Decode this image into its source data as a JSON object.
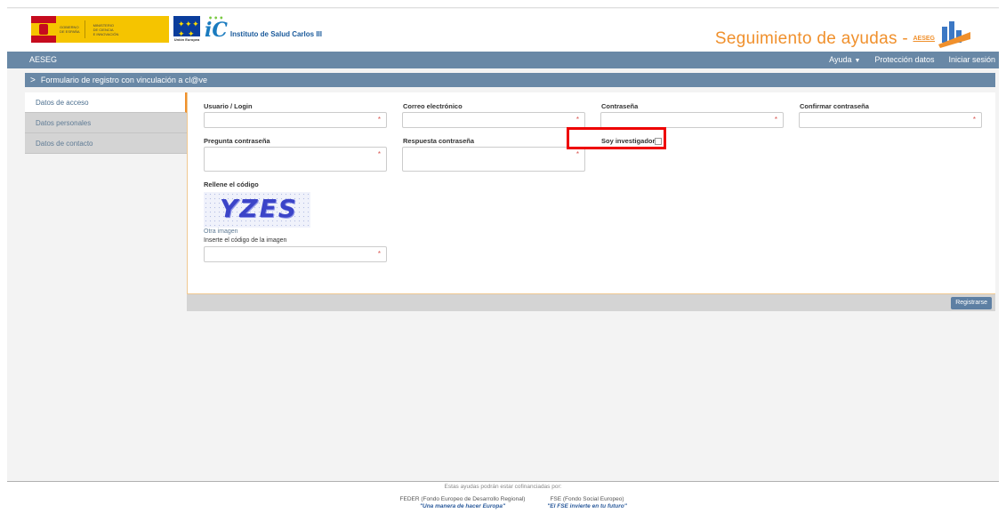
{
  "header": {
    "gov_logo": {
      "lines_a": [
        "GOBIERNO",
        "DE ESPAÑA"
      ],
      "lines_b": [
        "MINISTERIO",
        "DE CIENCIA",
        "E INNOVACIÓN"
      ],
      "flag_color": "#c60b1e",
      "band_color": "#f5c400"
    },
    "eu_logo": {
      "label": "Unión Europea",
      "color": "#0a3d9c"
    },
    "institute": {
      "name": "Instituto de Salud Carlos III",
      "color": "#1a7bbf"
    },
    "brand_title": "Seguimiento de ayudas -",
    "brand_short": "AESEG",
    "accent_color": "#f0902c"
  },
  "navbar": {
    "brand": "AESEG",
    "help": "Ayuda",
    "privacy": "Protección datos",
    "login": "Iniciar sesión",
    "color": "#6988a6"
  },
  "panel": {
    "title": "Formulario de registro con vinculación a cl@ve"
  },
  "sidebar": {
    "items": [
      {
        "label": "Datos de acceso"
      },
      {
        "label": "Datos personales"
      },
      {
        "label": "Datos de contacto"
      }
    ]
  },
  "form": {
    "usuario_label": "Usuario / Login",
    "correo_label": "Correo electrónico",
    "contrasena_label": "Contraseña",
    "confirmar_label": "Confirmar contraseña",
    "pregunta_label": "Pregunta contraseña",
    "respuesta_label": "Respuesta contraseña",
    "investigador_label": "Soy investigador",
    "required_mark": "*",
    "captcha_title": "Rellene el código",
    "captcha_code": "YZES",
    "other_image": "Otra imagen",
    "captcha_prompt": "Inserte el código de la imagen",
    "register_button": "Registrarse"
  },
  "footer": {
    "note": "Estas ayudas podrán estar cofinanciadas por:",
    "feder": "FEDER (Fondo Europeo de Desarrollo Regional)",
    "feder_motto": "\"Una manera de hacer Europa\"",
    "fse": "FSE (Fondo Social Europeo)",
    "fse_motto": "\"El FSE invierte en tu futuro\""
  }
}
